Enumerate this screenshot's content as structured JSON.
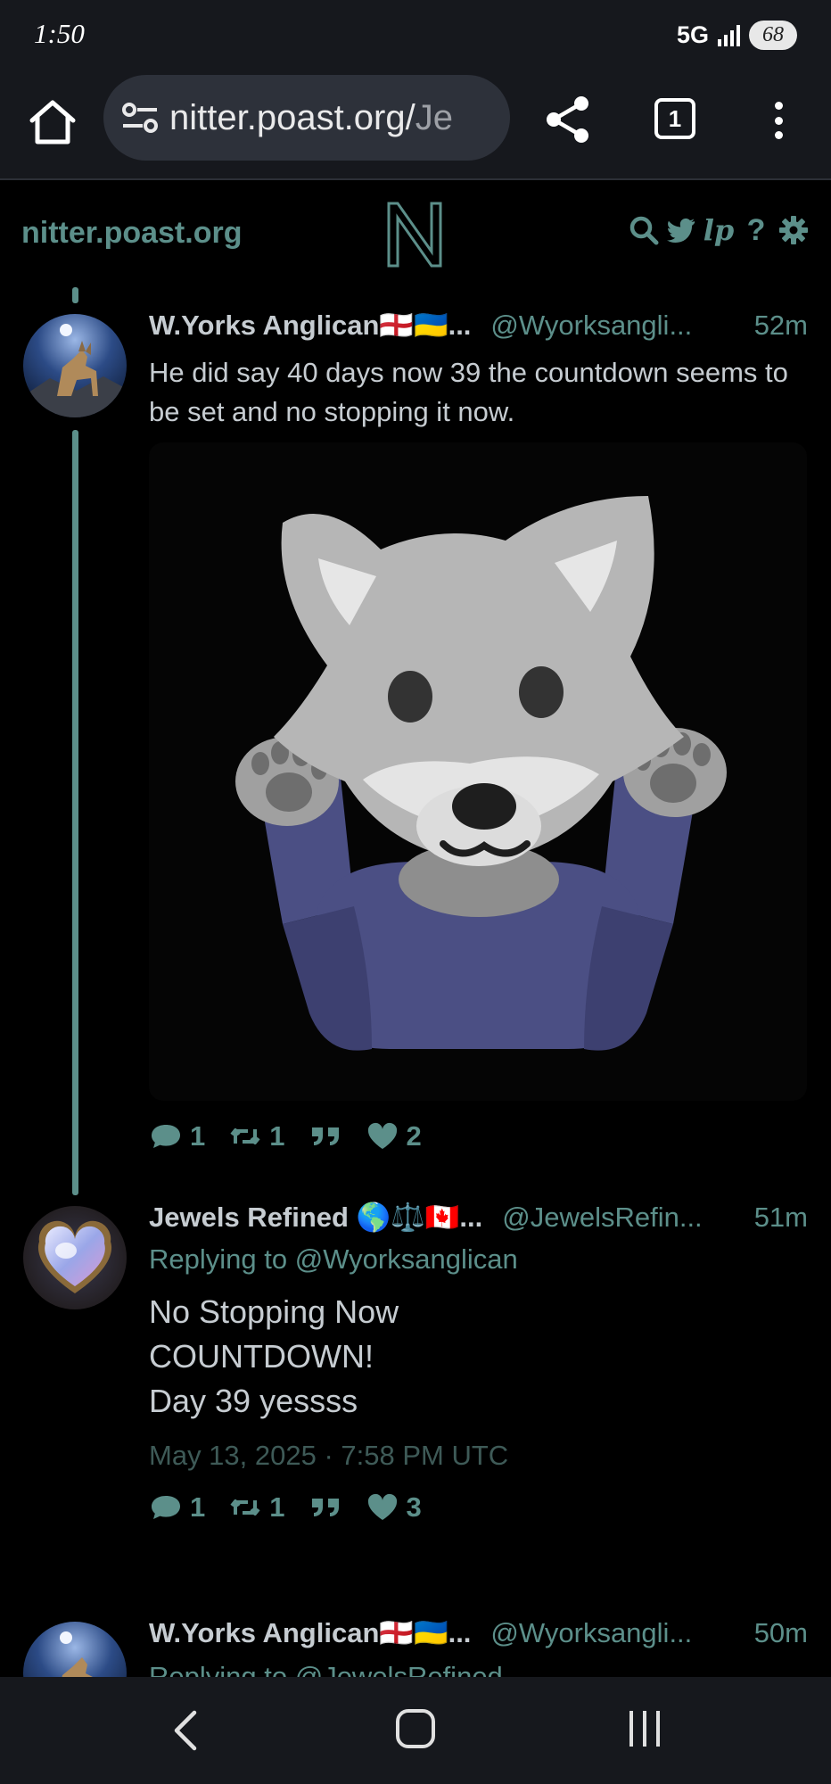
{
  "status_bar": {
    "time": "1:50",
    "network": "5G",
    "battery": "68"
  },
  "browser": {
    "url_main": "nitter.poast.org/",
    "url_tail": "Je",
    "tab_count": "1"
  },
  "nitter": {
    "site_name": "nitter.poast.org",
    "nav_icons": [
      "search-icon",
      "twitter-bird-icon",
      "liberapay-icon",
      "help-icon",
      "settings-gear-icon"
    ],
    "accent_color": "#5c8f8a"
  },
  "tweets": [
    {
      "name": "W.Yorks Anglican🏴󠁧󠁢󠁥󠁮󠁧󠁿🇺🇦...",
      "handle": "@Wyorksangli...",
      "time": "52m",
      "text": "He did say 40 days now 39 the countdown seems to be set and no stopping it now.",
      "media": "wolf-shrug-emoji-image",
      "replies": "1",
      "retweets": "1",
      "likes": "2"
    },
    {
      "name": "Jewels Refined 🌎⚖️🇨🇦...",
      "handle": "@JewelsRefin...",
      "time": "51m",
      "replying_prefix": "Replying to",
      "replying_to": "@Wyorksanglican",
      "text_lines": [
        "No Stopping Now",
        "COUNTDOWN!",
        "Day 39 yessss"
      ],
      "date": "May 13, 2025 · 7:58 PM UTC",
      "replies": "1",
      "retweets": "1",
      "likes": "3"
    },
    {
      "name": "W.Yorks Anglican🏴󠁧󠁢󠁥󠁮󠁧󠁿🇺🇦...",
      "handle": "@Wyorksangli...",
      "time": "50m",
      "replying_prefix": "Replying to",
      "replying_to": "@JewelsRefined"
    }
  ]
}
